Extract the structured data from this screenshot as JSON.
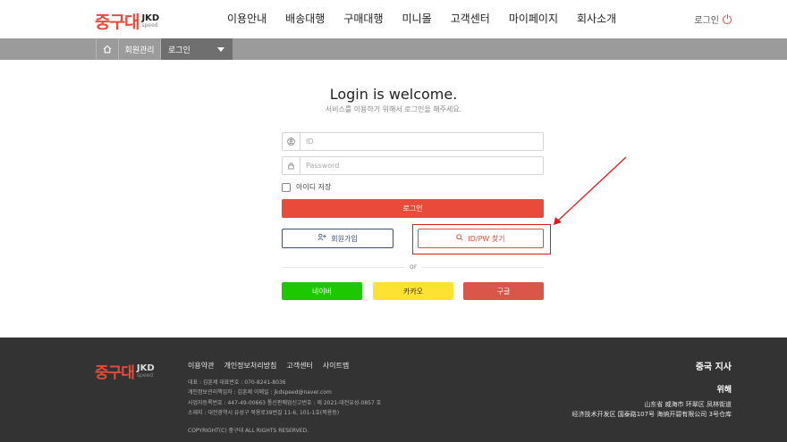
{
  "header": {
    "logo_ko": "중구대",
    "logo_en": "JKD",
    "logo_sub": "speed",
    "nav": [
      "이용안내",
      "배송대행",
      "구매대행",
      "미니몰",
      "고객센터",
      "마이페이지",
      "회사소개"
    ],
    "login_label": "로그인"
  },
  "breadcrumb": {
    "item": "회원관리",
    "select": "로그인"
  },
  "login": {
    "title": "Login is welcome.",
    "subtitle": "서비스를 이용하기 위해서 로그인을 해주세요.",
    "id_placeholder": "ID",
    "pw_placeholder": "Password",
    "remember_label": "아이디 저장",
    "login_button": "로그인",
    "join_button": "회원가입",
    "find_button": "ID/PW 찾기",
    "or_text": "or",
    "naver": "네이버",
    "kakao": "카카오",
    "google": "구글"
  },
  "colors": {
    "accent": "#e84b3a",
    "naver": "#1ec800",
    "kakao": "#fee233",
    "google": "#d9574a",
    "footer_bg": "#333333",
    "annotation": "#e01919"
  },
  "footer": {
    "logo_ko": "중구대",
    "logo_en": "JKD",
    "logo_sub": "speed",
    "links": [
      "이용약관",
      "개인정보처리방침",
      "고객센터",
      "사이트맵"
    ],
    "info": [
      "대표 : 김훈제   대표번호 : 070-8241-8036",
      "개인정보관리책임자 : 김훈제   이메일 : jkdspeed@naver.com",
      "사업자등록번호 : 447-49-00663   통신판매업신고번호 : 제 2021-대전유성-0857 호",
      "소재지 : 대전광역시 유성구 북용로39번길 11-6, 101-1호(북용동)"
    ],
    "copyright": "COPYRIGHT(C) 중구대 ALL RIGHTS RESERVED.",
    "branch_title": "중국 지사",
    "branch_city": "위해",
    "branch_addr1": "山东省 威海市 环翠区 凤林街道",
    "branch_addr2": "经济技术开发区 国泰路107号 海纳开碧有限公司 3号仓库"
  }
}
